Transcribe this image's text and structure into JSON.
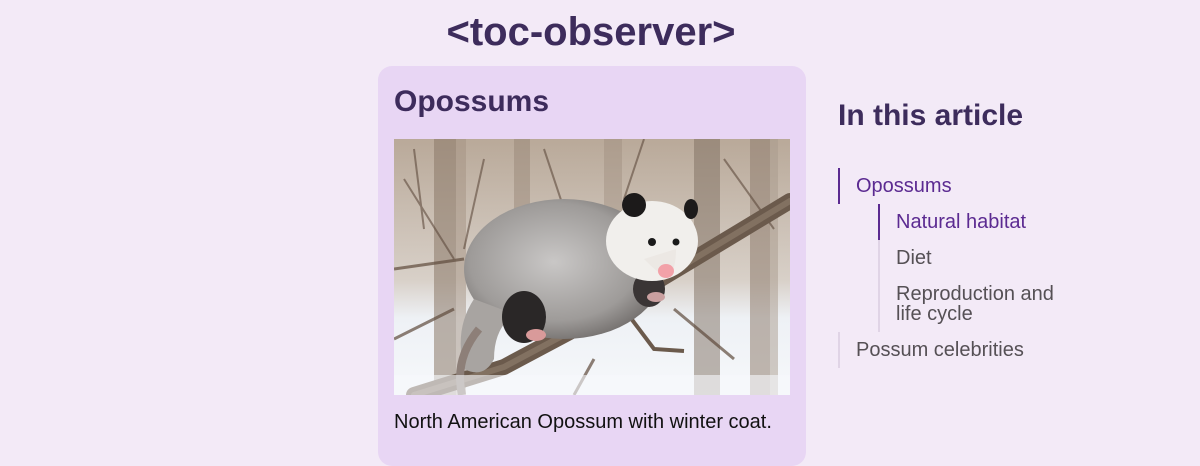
{
  "page": {
    "title": "<toc-observer>"
  },
  "article": {
    "heading": "Opossums",
    "image_alt": "Opossum on a branch in a snowy forest",
    "caption": "North American Opossum with winter coat."
  },
  "toc": {
    "heading": "In this article",
    "items": [
      {
        "label": "Opossums",
        "level": 1,
        "active": true
      },
      {
        "label": "Natural habitat",
        "level": 2,
        "active": true
      },
      {
        "label": "Diet",
        "level": 2,
        "active": false
      },
      {
        "label": "Reproduction and life cycle",
        "level": 2,
        "active": false
      },
      {
        "label": "Possum celebrities",
        "level": 1,
        "active": false
      }
    ],
    "colors": {
      "active": "#5b2a91",
      "inactive": "#555055",
      "bar_inactive": "#e0d4e6"
    }
  }
}
